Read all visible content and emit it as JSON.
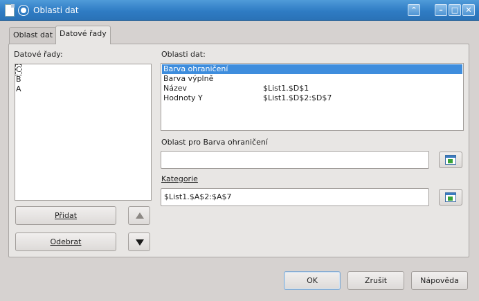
{
  "window": {
    "title": "Oblasti dat"
  },
  "tabs": [
    "Oblast dat",
    "Datové řady"
  ],
  "active_tab": 1,
  "series_panel": {
    "label": "Datové řady:",
    "items": [
      "C",
      "B",
      "A"
    ],
    "selected_index": 0
  },
  "ranges_panel": {
    "label": "Oblasti dat:",
    "rows": [
      {
        "role": "Barva ohraničení",
        "range": ""
      },
      {
        "role": "Barva výplně",
        "range": ""
      },
      {
        "role": "Název",
        "range": "$List1.$D$1"
      },
      {
        "role": "Hodnoty Y",
        "range": "$List1.$D$2:$D$7"
      }
    ],
    "selected_index": 0
  },
  "range_for": {
    "label": "Oblast pro Barva ohraničení",
    "value": ""
  },
  "categories": {
    "label": "Kategorie",
    "value": "$List1.$A$2:$A$7"
  },
  "buttons": {
    "add": "Přidat",
    "remove": "Odebrat",
    "ok": "OK",
    "cancel": "Zrušit",
    "help": "Nápověda"
  }
}
